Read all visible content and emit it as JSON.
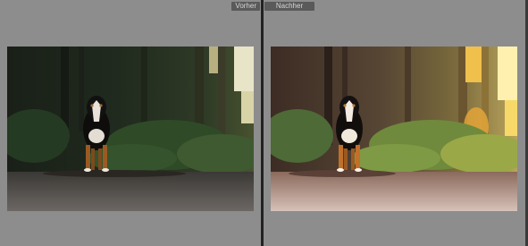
{
  "compare_view": {
    "before": {
      "label": "Vorher",
      "image": "dog-forest-photo-before"
    },
    "after": {
      "label": "Nachher",
      "image": "dog-forest-photo-after"
    }
  },
  "colors": {
    "pane_background": "#8d8d8d",
    "label_background": "#5a5a5a",
    "divider": "#222222"
  }
}
